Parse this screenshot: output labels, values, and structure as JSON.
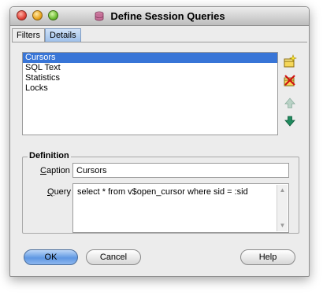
{
  "window": {
    "title": "Define Session Queries"
  },
  "tabs": [
    {
      "label": "Filters",
      "selected": false
    },
    {
      "label": "Details",
      "selected": true
    }
  ],
  "list": {
    "items": [
      "Cursors",
      "SQL Text",
      "Statistics",
      "Locks"
    ],
    "selected_index": 0
  },
  "definition": {
    "group_label": "Definition",
    "caption_label": {
      "mnemonic": "C",
      "rest": "aption"
    },
    "caption_value": "Cursors",
    "query_label": {
      "mnemonic": "Q",
      "rest": "uery"
    },
    "query_value": "select * from v$open_cursor where sid = :sid"
  },
  "buttons": {
    "ok": "OK",
    "cancel": "Cancel",
    "help": "Help"
  },
  "icons": {
    "title": "database-icon",
    "side": [
      "add-query-icon",
      "delete-query-icon",
      "move-up-icon",
      "move-down-icon"
    ]
  },
  "colors": {
    "selection": "#3875d7",
    "default_button": "#5f98e3"
  }
}
